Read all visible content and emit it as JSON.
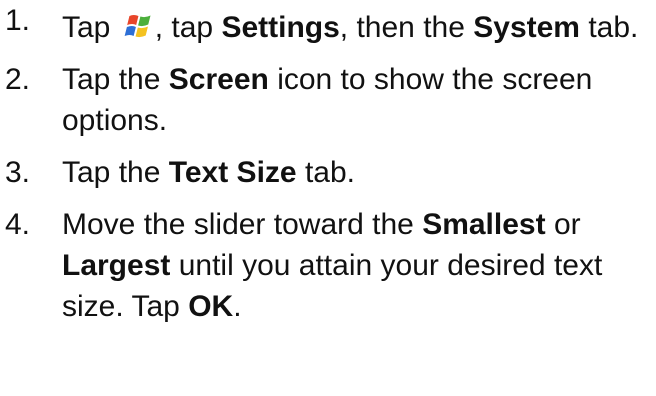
{
  "icons": {
    "start_menu": "windows-start-flag-icon"
  },
  "steps": [
    {
      "number": "1.",
      "parts": [
        "Tap",
        ", tap",
        "Settings",
        ", then the",
        "System",
        "tab."
      ]
    },
    {
      "number": "2.",
      "parts": [
        "Tap the",
        "Screen",
        "icon to show the screen options."
      ]
    },
    {
      "number": "3.",
      "parts": [
        "Tap the",
        "Text Size",
        "tab."
      ]
    },
    {
      "number": "4.",
      "parts": [
        "Move the slider toward the",
        "Smallest",
        "or",
        "Largest",
        "until you attain your desired text size. Tap",
        "OK",
        "."
      ]
    }
  ],
  "colors": {
    "flag_red": "#e8452a",
    "flag_green": "#4caf3c",
    "flag_blue": "#2d6fd6",
    "flag_yellow": "#f4c220"
  }
}
